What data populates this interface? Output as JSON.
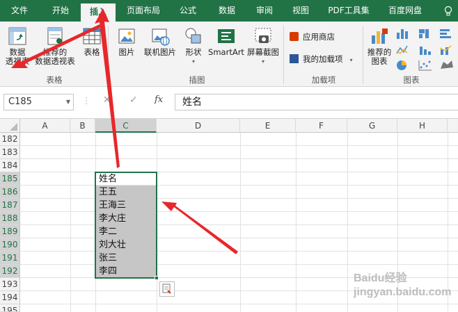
{
  "tabs": [
    "文件",
    "开始",
    "插入",
    "页面布局",
    "公式",
    "数据",
    "审阅",
    "视图",
    "PDF工具集",
    "百度网盘"
  ],
  "tell_me_icon": "lightbulb-icon",
  "ribbon": {
    "tables": {
      "pivot_line1": "数据",
      "pivot_line2": "透视表",
      "recommended_line1": "推荐的",
      "recommended_line2": "数据透视表",
      "table": "表格",
      "group": "表格"
    },
    "illustrations": {
      "pictures": "图片",
      "online_pictures": "联机图片",
      "shapes": "形状",
      "smartart": "SmartArt",
      "screenshot": "屏幕截图",
      "group": "插图"
    },
    "addins": {
      "store": "应用商店",
      "my_addins": "我的加载项",
      "group": "加载项"
    },
    "charts": {
      "recommended_line1": "推荐的",
      "recommended_line2": "图表",
      "group": "图表"
    }
  },
  "formula_bar": {
    "name_box": "C185",
    "fx": "fx",
    "value": "姓名"
  },
  "columns": [
    "A",
    "B",
    "C",
    "D",
    "E",
    "F",
    "G",
    "H"
  ],
  "selected_column": "C",
  "rows": [
    "182",
    "183",
    "184",
    "185",
    "186",
    "187",
    "188",
    "189",
    "190",
    "191",
    "192",
    "193",
    "194",
    "195"
  ],
  "selected_rows": [
    "185",
    "186",
    "187",
    "188",
    "189",
    "190",
    "191",
    "192"
  ],
  "cells": [
    "姓名",
    "王五",
    "王海三",
    "李大庄",
    "李二",
    "刘大壮",
    "张三",
    "李四"
  ],
  "watermark": "Baidu经验 jingyan.baidu.com",
  "colors": {
    "accent": "#217346",
    "arrow": "#e8272b",
    "selection_fill": "#c6c6c6"
  }
}
